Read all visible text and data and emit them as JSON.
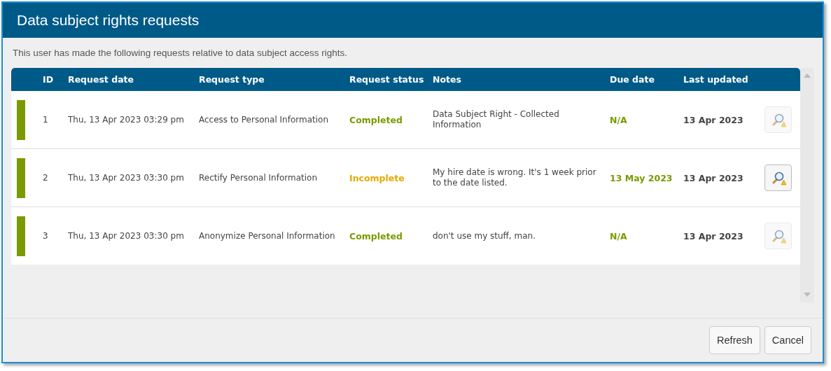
{
  "window": {
    "title": "Data subject rights requests"
  },
  "intro": "This user has made the following requests relative to data subject access rights.",
  "table": {
    "columns": [
      "ID",
      "Request date",
      "Request type",
      "Request status",
      "Notes",
      "Due date",
      "Last updated"
    ],
    "rows": [
      {
        "color": "#7a9a01",
        "id": "1",
        "request_date": "Thu, 13 Apr 2023 03:29 pm",
        "request_type": "Access to Personal Information",
        "status": {
          "text": "Completed",
          "color": "#7a9a01"
        },
        "notes": "Data Subject Right - Collected Information",
        "due_date": "N/A",
        "last_updated": "13 Apr 2023",
        "view_disabled": true
      },
      {
        "color": "#7a9a01",
        "id": "2",
        "request_date": "Thu, 13 Apr 2023 03:30 pm",
        "request_type": "Rectify Personal Information",
        "status": {
          "text": "Incomplete",
          "color": "#e8a800"
        },
        "notes": "My hire date is wrong. It's 1 week prior to the date listed.",
        "due_date": "13 May 2023",
        "last_updated": "13 Apr 2023",
        "view_disabled": false
      },
      {
        "color": "#7a9a01",
        "id": "3",
        "request_date": "Thu, 13 Apr 2023 03:30 pm",
        "request_type": "Anonymize Personal Information",
        "status": {
          "text": "Completed",
          "color": "#7a9a01"
        },
        "notes": "don't use my stuff, man.",
        "due_date": "N/A",
        "last_updated": "13 Apr 2023",
        "view_disabled": true
      }
    ]
  },
  "buttons": [
    "Refresh",
    "Cancel"
  ]
}
